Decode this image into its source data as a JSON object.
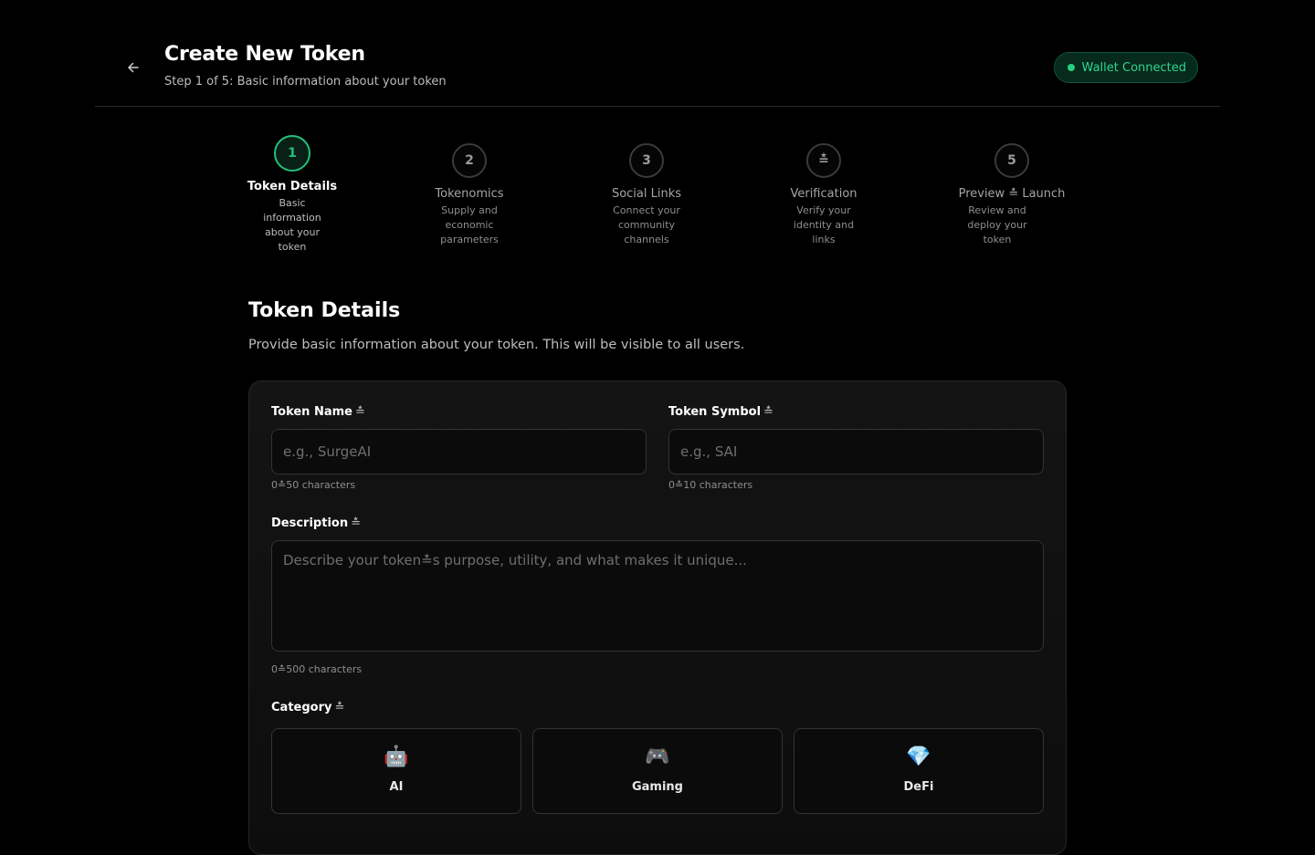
{
  "header": {
    "title": "Create New Token",
    "subtitle": "Step 1 of 5: Basic information about your token",
    "wallet_status": "Wallet Connected"
  },
  "steps": [
    {
      "number": "1",
      "title": "Token Details",
      "desc": "Basic information about your token",
      "state": "active"
    },
    {
      "number": "2",
      "title": "Tokenomics",
      "desc": "Supply and economic parameters",
      "state": "pending"
    },
    {
      "number": "3",
      "title": "Social Links",
      "desc": "Connect your community channels",
      "state": "pending"
    },
    {
      "number": "≛",
      "title": "Verification",
      "desc": "Verify your identity and links",
      "state": "pending"
    },
    {
      "number": "5",
      "title": "Preview ≛ Launch",
      "desc": "Review and deploy your token",
      "state": "pending"
    }
  ],
  "section": {
    "title": "Token Details",
    "description": "Provide basic information about your token. This will be visible to all users."
  },
  "form": {
    "token_name": {
      "label": "Token Name",
      "required_mark": "≛",
      "placeholder": "e.g., SurgeAI",
      "value": "",
      "hint": "0≛50 characters"
    },
    "token_symbol": {
      "label": "Token Symbol",
      "required_mark": "≛",
      "placeholder": "e.g., SAI",
      "value": "",
      "hint": "0≛10 characters"
    },
    "description": {
      "label": "Description",
      "required_mark": "≛",
      "placeholder": "Describe your token≛s purpose, utility, and what makes it unique...",
      "value": "",
      "hint": "0≛500 characters"
    },
    "category": {
      "label": "Category",
      "required_mark": "≛",
      "options": [
        {
          "icon": "🤖",
          "icon_name": "robot-icon",
          "label": "AI"
        },
        {
          "icon": "🎮",
          "icon_name": "gamepad-icon",
          "label": "Gaming"
        },
        {
          "icon": "💎",
          "icon_name": "gem-icon",
          "label": "DeFi"
        }
      ]
    }
  },
  "colors": {
    "accent": "#22c17a",
    "background": "#000000",
    "card": "#141414",
    "wallet_badge_bg": "#062a1c"
  }
}
